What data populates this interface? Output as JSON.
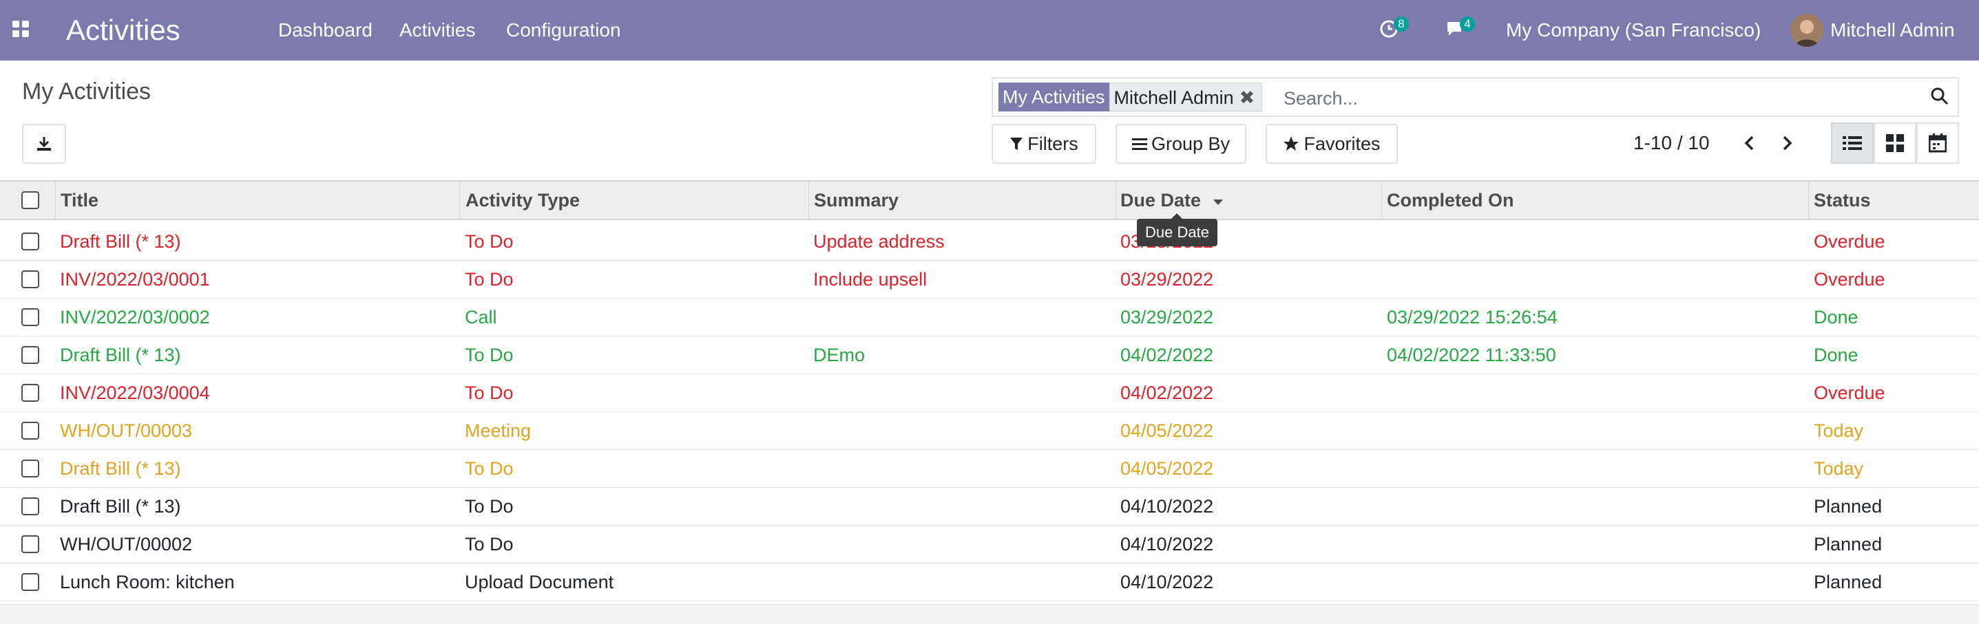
{
  "navbar": {
    "app_title": "Activities",
    "menu": [
      "Dashboard",
      "Activities",
      "Configuration"
    ],
    "activity_badge": "8",
    "message_badge": "4",
    "company": "My Company (San Francisco)",
    "user": "Mitchell Admin",
    "icons": {
      "apps": "apps-grid-icon",
      "activity": "clock-icon",
      "messages": "chat-icon"
    }
  },
  "control_panel": {
    "breadcrumb": "My Activities",
    "search": {
      "facet_label": "My Activities",
      "facet_value": "Mitchell Admin",
      "placeholder": "Search..."
    },
    "filters_label": "Filters",
    "group_by_label": "Group By",
    "favorites_label": "Favorites",
    "pager": "1-10 / 10",
    "views": [
      "list-view-icon",
      "kanban-view-icon",
      "calendar-view-icon"
    ]
  },
  "table": {
    "columns": [
      "Title",
      "Activity Type",
      "Summary",
      "Due Date",
      "Completed On",
      "Status"
    ],
    "tooltip": "Due Date",
    "status_colors": {
      "Overdue": "#d9232d",
      "Done": "#28a745",
      "Today": "#e0a421",
      "Planned": "#212529"
    },
    "rows": [
      {
        "title": "Draft Bill (* 13)",
        "type": "To Do",
        "summary": "Update address",
        "due": "03/28/2022",
        "completed": "",
        "status": "Overdue"
      },
      {
        "title": "INV/2022/03/0001",
        "type": "To Do",
        "summary": "Include upsell",
        "due": "03/29/2022",
        "completed": "",
        "status": "Overdue"
      },
      {
        "title": "INV/2022/03/0002",
        "type": "Call",
        "summary": "",
        "due": "03/29/2022",
        "completed": "03/29/2022 15:26:54",
        "status": "Done"
      },
      {
        "title": "Draft Bill (* 13)",
        "type": "To Do",
        "summary": "DEmo",
        "due": "04/02/2022",
        "completed": "04/02/2022 11:33:50",
        "status": "Done"
      },
      {
        "title": "INV/2022/03/0004",
        "type": "To Do",
        "summary": "",
        "due": "04/02/2022",
        "completed": "",
        "status": "Overdue"
      },
      {
        "title": "WH/OUT/00003",
        "type": "Meeting",
        "summary": "",
        "due": "04/05/2022",
        "completed": "",
        "status": "Today"
      },
      {
        "title": "Draft Bill (* 13)",
        "type": "To Do",
        "summary": "",
        "due": "04/05/2022",
        "completed": "",
        "status": "Today"
      },
      {
        "title": "Draft Bill (* 13)",
        "type": "To Do",
        "summary": "",
        "due": "04/10/2022",
        "completed": "",
        "status": "Planned"
      },
      {
        "title": "WH/OUT/00002",
        "type": "To Do",
        "summary": "",
        "due": "04/10/2022",
        "completed": "",
        "status": "Planned"
      },
      {
        "title": "Lunch Room: kitchen",
        "type": "Upload Document",
        "summary": "",
        "due": "04/10/2022",
        "completed": "",
        "status": "Planned"
      }
    ]
  }
}
